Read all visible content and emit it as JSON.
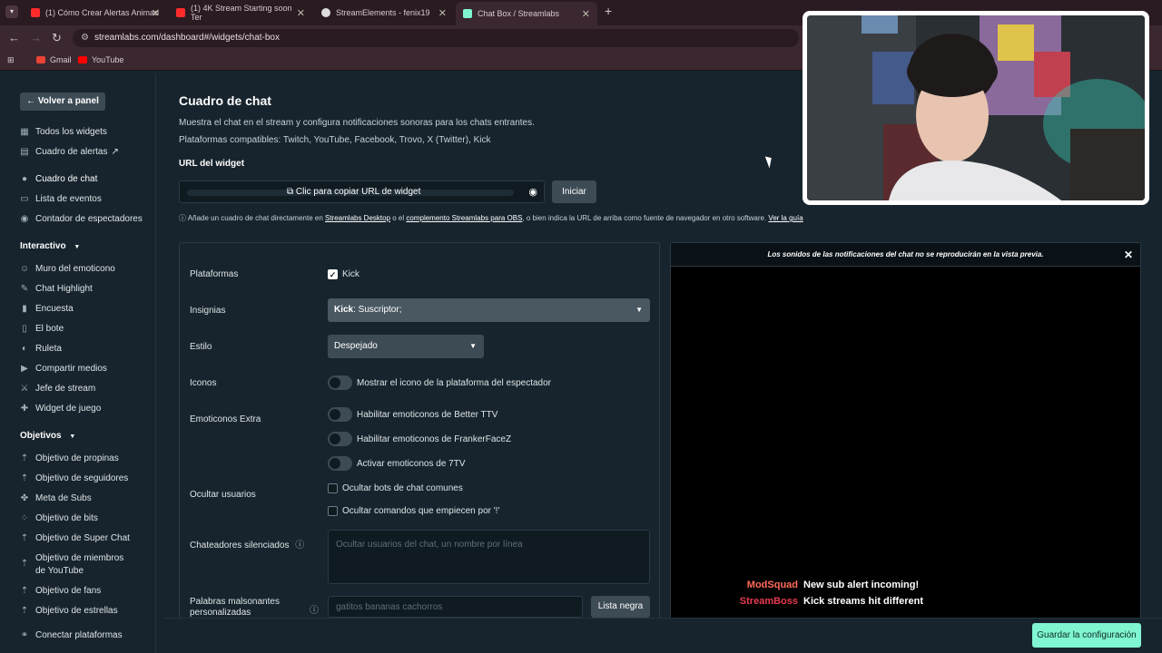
{
  "browser": {
    "tabs": [
      {
        "title": "(1) Cómo Crear Alertas Animad",
        "icon": "youtube-icon",
        "color": "#ff2b2b"
      },
      {
        "title": "(1) 4K Stream Starting soon Ter",
        "icon": "youtube-icon",
        "color": "#ff2b2b"
      },
      {
        "title": "StreamElements - fenix19",
        "icon": "streamelements-icon",
        "color": "#dddddd"
      },
      {
        "title": "Chat Box / Streamlabs",
        "icon": "streamlabs-icon",
        "color": "#80f5d2"
      }
    ],
    "url": "streamlabs.com/dashboard#/widgets/chat-box",
    "bookmarks": [
      {
        "label": "Gmail",
        "icon": "gmail-icon"
      },
      {
        "label": "YouTube",
        "icon": "youtube-icon"
      }
    ]
  },
  "sidebar": {
    "back_label": "Volver a panel",
    "top_items": [
      {
        "label": "Todos los widgets",
        "icon": "grid-icon"
      },
      {
        "label": "Cuadro de alertas",
        "icon": "alert-box-icon"
      },
      {
        "label": "Cuadro de chat",
        "icon": "chat-icon"
      },
      {
        "label": "Lista de eventos",
        "icon": "list-icon"
      },
      {
        "label": "Contador de espectadores",
        "icon": "eye-icon"
      }
    ],
    "section_interactivo": "Interactivo",
    "interactivo_items": [
      {
        "label": "Muro del emoticono",
        "icon": "emote-icon"
      },
      {
        "label": "Chat Highlight",
        "icon": "highlight-icon"
      },
      {
        "label": "Encuesta",
        "icon": "poll-icon"
      },
      {
        "label": "El bote",
        "icon": "jar-icon"
      },
      {
        "label": "Ruleta",
        "icon": "wheel-icon"
      },
      {
        "label": "Compartir medios",
        "icon": "media-icon"
      },
      {
        "label": "Jefe de stream",
        "icon": "boss-icon"
      },
      {
        "label": "Widget de juego",
        "icon": "game-icon"
      }
    ],
    "section_objetivos": "Objetivos",
    "objetivos_items": [
      {
        "label": "Objetivo de propinas",
        "icon": "tip-icon"
      },
      {
        "label": "Objetivo de seguidores",
        "icon": "followers-icon"
      },
      {
        "label": "Meta de Subs",
        "icon": "subs-icon"
      },
      {
        "label": "Objetivo de bits",
        "icon": "bits-icon"
      },
      {
        "label": "Objetivo de Super Chat",
        "icon": "superchat-icon"
      },
      {
        "label": "Objetivo de miembros de YouTube",
        "icon": "members-icon"
      },
      {
        "label": "Objetivo de fans",
        "icon": "fans-icon"
      },
      {
        "label": "Objetivo de estrellas",
        "icon": "stars-icon"
      }
    ],
    "connect_label": "Conectar plataformas"
  },
  "main": {
    "title": "Cuadro de chat",
    "description": "Muestra el chat en el stream y configura notificaciones sonoras para los chats entrantes.",
    "platforms_line": "Plataformas compatibles: Twitch, YouTube, Facebook, Trovo, X (Twitter), Kick",
    "url_label": "URL del widget",
    "copy_label": "Clic para copiar URL de widget",
    "start_label": "Iniciar",
    "info": {
      "p1": "Añade un cuadro de chat directamente en ",
      "link1": "Streamlabs Desktop",
      "p2": " o el ",
      "link2": "complemento Streamlabs para OBS",
      "p3": ", o bien indica la URL de arriba como fuente de navegador en otro software. ",
      "link3": "Ver la guía"
    }
  },
  "form": {
    "platforms_label": "Plataformas",
    "platform_kick": "Kick",
    "badges_label": "Insignias",
    "badges_value_bold": "Kick",
    "badges_value_rest": ": Suscriptor;",
    "style_label": "Estilo",
    "style_value": "Despejado",
    "icons_label": "Iconos",
    "icons_toggle": "Mostrar el icono de la plataforma del espectador",
    "extra_label": "Emoticonos Extra",
    "extra_ttv": "Habilitar emoticonos de Better TTV",
    "extra_ffz": "Habilitar emoticonos de FrankerFaceZ",
    "extra_7tv": "Activar emoticonos de 7TV",
    "hide_label": "Ocultar usuarios",
    "hide_bots": "Ocultar bots de chat comunes",
    "hide_commands": "Ocultar comandos que empiecen por '!'",
    "muted_label": "Chateadores silenciados",
    "muted_placeholder": "Ocultar usuarios del chat, un nombre por línea",
    "words_label": "Palabras malsonantes personalizadas",
    "words_placeholder": "gatitos bananas cachorros",
    "blacklist_label": "Lista negra"
  },
  "preview": {
    "header": "Los sonidos de las notificaciones del chat no se reproducirán en la vista previa.",
    "messages": [
      {
        "name": "ModSquad",
        "text": "New sub alert incoming!",
        "color": "#ff6b5b"
      },
      {
        "name": "StreamBoss",
        "text": "Kick streams hit different",
        "color": "#e83a4f"
      }
    ]
  },
  "footer": {
    "save_label": "Guardar la configuración"
  },
  "colors": {
    "accent": "#80f5d2",
    "background": "#17242d"
  }
}
